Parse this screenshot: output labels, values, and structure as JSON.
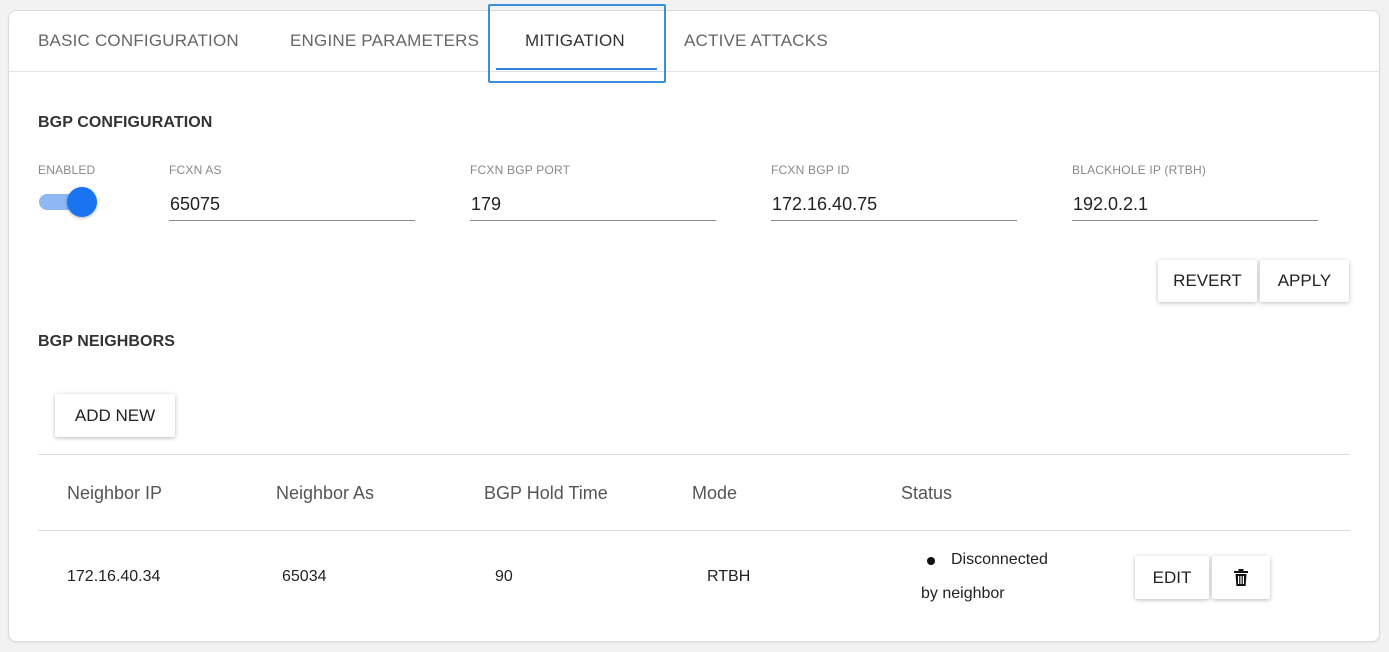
{
  "tabs": [
    {
      "label": "BASIC CONFIGURATION"
    },
    {
      "label": "ENGINE PARAMETERS"
    },
    {
      "label": "MITIGATION"
    },
    {
      "label": "ACTIVE ATTACKS"
    }
  ],
  "bgp_config": {
    "title": "BGP CONFIGURATION",
    "enabled_label": "ENABLED",
    "enabled": true,
    "fields": [
      {
        "label": "FCXN AS",
        "value": "65075"
      },
      {
        "label": "FCXN BGP PORT",
        "value": "179"
      },
      {
        "label": "FCXN BGP ID",
        "value": "172.16.40.75"
      },
      {
        "label": "BLACKHOLE IP (RTBH)",
        "value": "192.0.2.1"
      }
    ],
    "revert_label": "REVERT",
    "apply_label": "APPLY"
  },
  "neighbors": {
    "title": "BGP NEIGHBORS",
    "add_label": "ADD NEW",
    "columns": [
      "Neighbor IP",
      "Neighbor As",
      "BGP Hold Time",
      "Mode",
      "Status"
    ],
    "rows": [
      {
        "ip": "172.16.40.34",
        "as": "65034",
        "hold_time": "90",
        "mode": "RTBH",
        "status_line1": "Disconnected",
        "status_line2": "by neighbor",
        "edit_label": "EDIT",
        "delete_icon": "trash-icon"
      }
    ]
  },
  "colors": {
    "accent": "#1a73f0",
    "tab_focus": "#3a8fdc"
  }
}
